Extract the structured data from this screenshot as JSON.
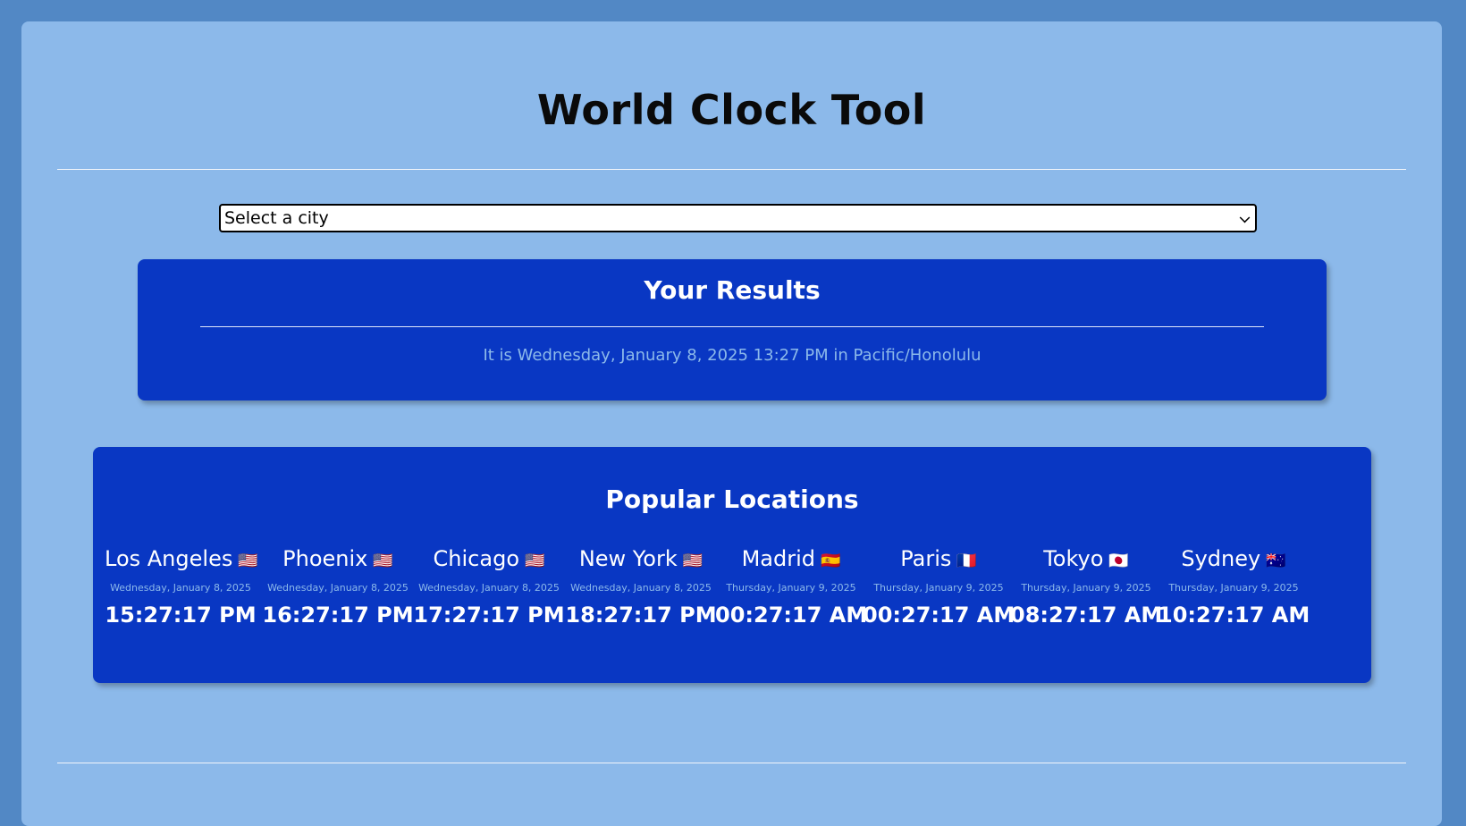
{
  "page": {
    "title": "World Clock Tool"
  },
  "city_select": {
    "selected": "Select a city"
  },
  "results": {
    "heading": "Your Results",
    "text": "It is Wednesday, January 8, 2025 13:27 PM in Pacific/Honolulu"
  },
  "popular": {
    "heading": "Popular Locations",
    "locations": [
      {
        "city": "Los Angeles",
        "flag": "🇺🇸",
        "date": "Wednesday, January 8, 2025",
        "time": "15:27:17 PM"
      },
      {
        "city": "Phoenix",
        "flag": "🇺🇸",
        "date": "Wednesday, January 8, 2025",
        "time": "16:27:17 PM"
      },
      {
        "city": "Chicago",
        "flag": "🇺🇸",
        "date": "Wednesday, January 8, 2025",
        "time": "17:27:17 PM"
      },
      {
        "city": "New York",
        "flag": "🇺🇸",
        "date": "Wednesday, January 8, 2025",
        "time": "18:27:17 PM"
      },
      {
        "city": "Madrid",
        "flag": "🇪🇸",
        "date": "Thursday, January 9, 2025",
        "time": "00:27:17 AM"
      },
      {
        "city": "Paris",
        "flag": "🇫🇷",
        "date": "Thursday, January 9, 2025",
        "time": "00:27:17 AM"
      },
      {
        "city": "Tokyo",
        "flag": "🇯🇵",
        "date": "Thursday, January 9, 2025",
        "time": "08:27:17 AM"
      },
      {
        "city": "Sydney",
        "flag": "🇦🇺",
        "date": "Thursday, January 9, 2025",
        "time": "10:27:17 AM"
      }
    ]
  },
  "colors": {
    "page_background": "#5288c5",
    "container_background": "#8cb9ea",
    "panel_background": "#0937c3",
    "muted_text": "#8cb9ea"
  }
}
